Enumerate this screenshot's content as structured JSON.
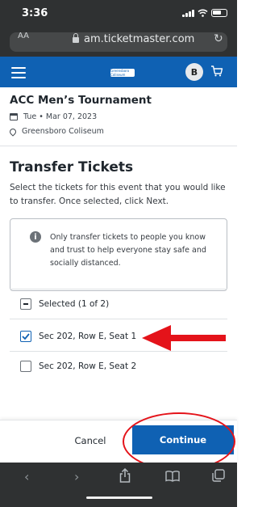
{
  "status_bar": {
    "time": "3:36"
  },
  "browser": {
    "text_size_label": "AA",
    "url": "am.ticketmaster.com",
    "reload_icon": "reload-icon"
  },
  "header": {
    "logo_text": "Greensboro Coliseum",
    "avatar_initial": "B",
    "brand_color": "#0f61b3"
  },
  "event": {
    "title": "ACC Men’s Tournament",
    "date": "Tue • Mar 07, 2023",
    "venue": "Greensboro Coliseum"
  },
  "transfer": {
    "heading": "Transfer Tickets",
    "description": "Select the tickets for this event that you would like to transfer. Once selected, click Next.",
    "alert": "Only transfer tickets to people you know and trust to help everyone stay safe and socially distanced.",
    "selected_summary": "Selected (1 of 2)",
    "tickets": [
      {
        "label": "Sec 202, Row E, Seat 1",
        "checked": true
      },
      {
        "label": "Sec 202, Row E, Seat 2",
        "checked": false
      }
    ]
  },
  "footer": {
    "cancel_label": "Cancel",
    "continue_label": "Continue"
  },
  "annotations": {
    "arrow_color": "#e4131a",
    "ring_color": "#e4131a"
  },
  "toolbar": {
    "icons": [
      "back-icon",
      "forward-icon",
      "share-icon",
      "bookmarks-icon",
      "tabs-icon"
    ]
  }
}
